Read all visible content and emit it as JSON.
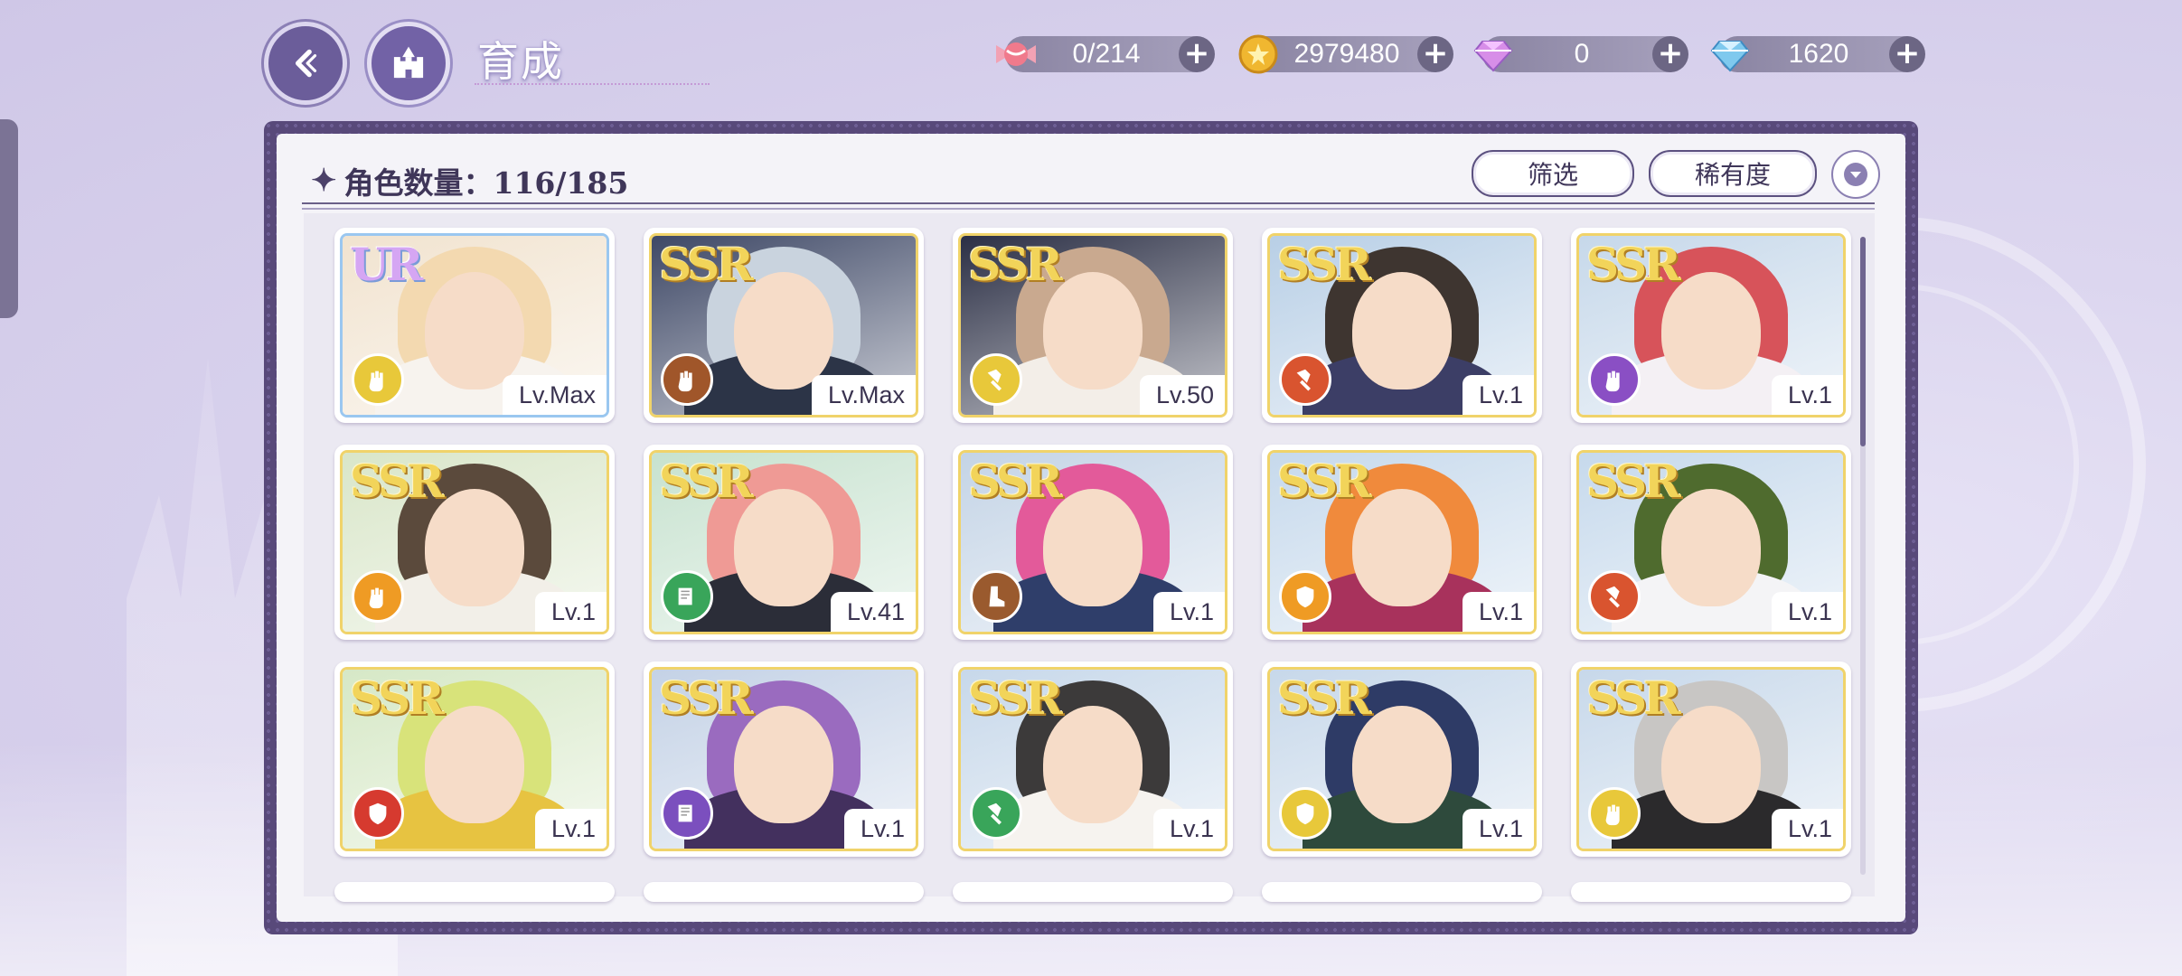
{
  "header": {
    "title": "育成",
    "title_script": "Growth"
  },
  "currencies": [
    {
      "name": "candy",
      "value": "0/214",
      "color": "#f07a8c"
    },
    {
      "name": "gold-coin",
      "value": "2979480",
      "color": "#f0b730"
    },
    {
      "name": "pink-diamond",
      "value": "0",
      "color": "#d78ee8"
    },
    {
      "name": "blue-diamond",
      "value": "1620",
      "color": "#7fc9ee"
    }
  ],
  "panel": {
    "count_label": "角色数量：116/185",
    "filter_label": "筛选",
    "rarity_label": "稀有度"
  },
  "colors": {
    "panel_frame": "#58497a",
    "ssr_gold": "#f2d45a",
    "ur_purple": "#d5a6f3"
  },
  "cards": [
    {
      "rarity": "UR",
      "level": "Lv.Max",
      "type": "fist",
      "type_color": "#e8c83a",
      "hair": "#f3d9b0",
      "bg": "#f1e3cf",
      "cloth": "#f7f3ee"
    },
    {
      "rarity": "SSR",
      "level": "Lv.Max",
      "type": "fist",
      "type_color": "#a0562a",
      "hair": "#c9d3de",
      "bg": "#3e4866",
      "cloth": "#2c3447"
    },
    {
      "rarity": "SSR",
      "level": "Lv.50",
      "type": "hammer",
      "type_color": "#e8c83a",
      "hair": "#c9a98f",
      "bg": "#2b2f45",
      "cloth": "#f3eee8"
    },
    {
      "rarity": "SSR",
      "level": "Lv.1",
      "type": "hammer",
      "type_color": "#d9542f",
      "hair": "#3e3530",
      "bg": "#b8cfe6",
      "cloth": "#3c3e66"
    },
    {
      "rarity": "SSR",
      "level": "Lv.1",
      "type": "fist",
      "type_color": "#8a4fc4",
      "hair": "#d7535a",
      "bg": "#c6d8ea",
      "cloth": "#f4f0f4"
    },
    {
      "rarity": "SSR",
      "level": "Lv.1",
      "type": "fist",
      "type_color": "#ef9b24",
      "hair": "#5b4a3c",
      "bg": "#d9e6c9",
      "cloth": "#f2efe8"
    },
    {
      "rarity": "SSR",
      "level": "Lv.41",
      "type": "book",
      "type_color": "#39a55a",
      "hair": "#ef9a95",
      "bg": "#c7e2cf",
      "cloth": "#2b2d38"
    },
    {
      "rarity": "SSR",
      "level": "Lv.1",
      "type": "boot",
      "type_color": "#9a5a2e",
      "hair": "#e35a9a",
      "bg": "#c4d4e6",
      "cloth": "#2f3e6a"
    },
    {
      "rarity": "SSR",
      "level": "Lv.1",
      "type": "shield",
      "type_color": "#ef9b24",
      "hair": "#f08a3c",
      "bg": "#c6d9ec",
      "cloth": "#a8325c"
    },
    {
      "rarity": "SSR",
      "level": "Lv.1",
      "type": "hammer",
      "type_color": "#d9542f",
      "hair": "#4f6b2e",
      "bg": "#c6d9ec",
      "cloth": "#f4f4f6"
    },
    {
      "rarity": "SSR",
      "level": "Lv.1",
      "type": "shield",
      "type_color": "#d63a2f",
      "hair": "#d8e37a",
      "bg": "#d6e8c6",
      "cloth": "#e7c341"
    },
    {
      "rarity": "SSR",
      "level": "Lv.1",
      "type": "book",
      "type_color": "#7b4fbe",
      "hair": "#9a6bbf",
      "bg": "#c4d2e6",
      "cloth": "#43305e"
    },
    {
      "rarity": "SSR",
      "level": "Lv.1",
      "type": "hammer",
      "type_color": "#39a55a",
      "hair": "#3c3a3a",
      "bg": "#c7d8ea",
      "cloth": "#f6f3ef"
    },
    {
      "rarity": "SSR",
      "level": "Lv.1",
      "type": "shield",
      "type_color": "#e8c83a",
      "hair": "#2e3b66",
      "bg": "#c7d8ea",
      "cloth": "#2e4a3c"
    },
    {
      "rarity": "SSR",
      "level": "Lv.1",
      "type": "fist",
      "type_color": "#e8c83a",
      "hair": "#c8c6c4",
      "bg": "#c7d8ea",
      "cloth": "#2b2a2c"
    }
  ]
}
